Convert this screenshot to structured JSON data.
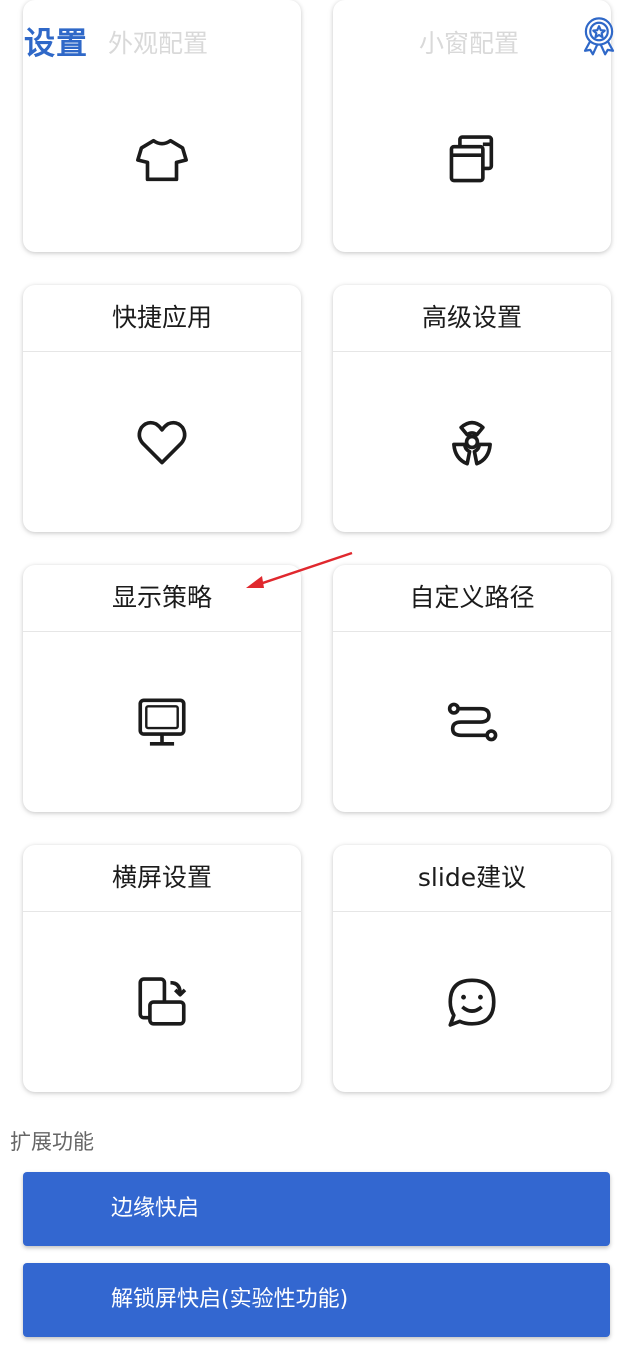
{
  "header": {
    "title": "设置",
    "faded_labels": [
      "外观配置",
      "小窗配置"
    ],
    "badge_icon": "award-badge-icon"
  },
  "cards": [
    {
      "label": "",
      "icon": "tshirt-icon"
    },
    {
      "label": "",
      "icon": "windows-icon"
    },
    {
      "label": "快捷应用",
      "icon": "heart-icon"
    },
    {
      "label": "高级设置",
      "icon": "radiation-icon"
    },
    {
      "label": "显示策略",
      "icon": "monitor-icon"
    },
    {
      "label": "自定义路径",
      "icon": "route-icon"
    },
    {
      "label": "横屏设置",
      "icon": "rotate-screen-icon"
    },
    {
      "label": "slide建议",
      "icon": "smiley-chat-icon"
    }
  ],
  "section": {
    "title": "扩展功能",
    "buttons": [
      {
        "label": "边缘快启"
      },
      {
        "label": "解锁屏快启(实验性功能)"
      }
    ]
  },
  "colors": {
    "accent": "#3367d0",
    "title": "#2f68c8",
    "annotation_arrow": "#e0282e"
  }
}
